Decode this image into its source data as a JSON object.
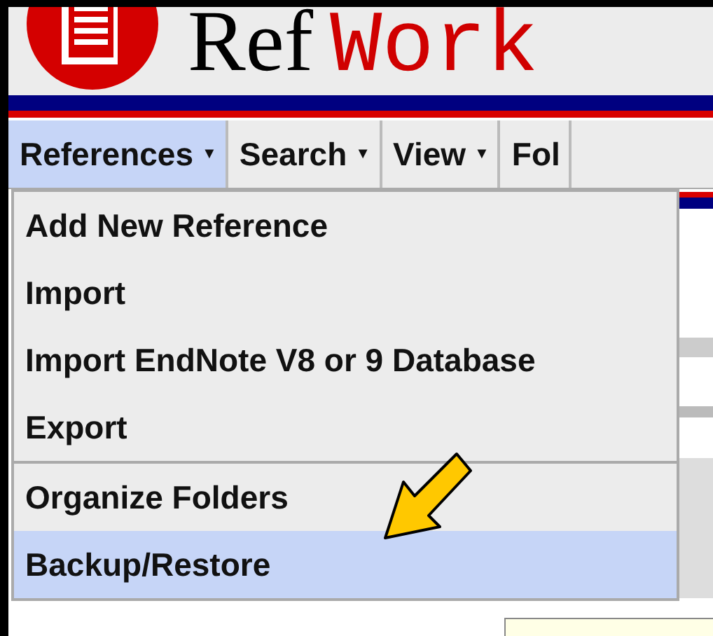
{
  "logo": {
    "part_1": "Ref",
    "part_2": "Work"
  },
  "menu_bar": [
    {
      "label": "References",
      "caret": "▼",
      "selected": true
    },
    {
      "label": "Search",
      "caret": "▼",
      "selected": false
    },
    {
      "label": "View",
      "caret": "▼",
      "selected": false
    },
    {
      "label": "Fol",
      "selected": false
    }
  ],
  "dropdown": [
    {
      "label": "Add New Reference",
      "selected": false,
      "divider_before": false
    },
    {
      "label": "Import",
      "selected": false,
      "divider_before": false
    },
    {
      "label": "Import EndNote V8 or 9 Database",
      "selected": false,
      "divider_before": false
    },
    {
      "label": "Export",
      "selected": false,
      "divider_before": false
    },
    {
      "label": "Organize Folders",
      "selected": false,
      "divider_before": true
    },
    {
      "label": "Backup/Restore",
      "selected": true,
      "divider_before": false
    }
  ]
}
